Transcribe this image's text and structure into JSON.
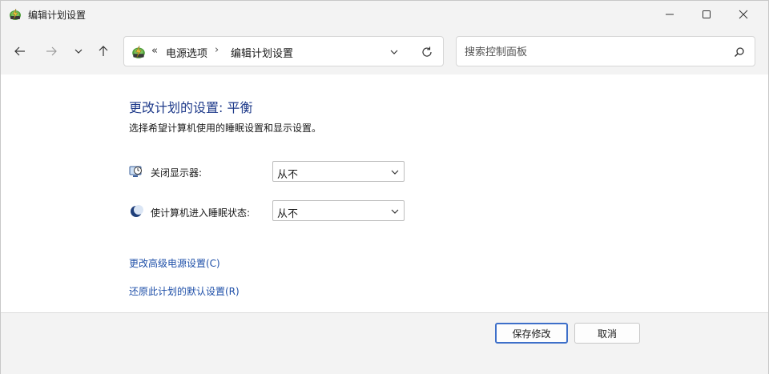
{
  "window": {
    "title": "编辑计划设置",
    "minimize_icon": "minimize-icon",
    "maximize_icon": "maximize-icon",
    "close_icon": "close-icon"
  },
  "nav": {
    "back_icon": "arrow-left-icon",
    "forward_icon": "arrow-right-icon",
    "recent_icon": "chevron-down-icon",
    "up_icon": "arrow-up-icon"
  },
  "address": {
    "overflow": "«",
    "crumbs": [
      "电源选项",
      "编辑计划设置"
    ],
    "separator": "›"
  },
  "search": {
    "placeholder": "搜索控制面板"
  },
  "main": {
    "title": "更改计划的设置: 平衡",
    "subtitle": "选择希望计算机使用的睡眠设置和显示设置。",
    "settings": [
      {
        "label": "关闭显示器:",
        "value": "从不",
        "icon": "display-timer-icon"
      },
      {
        "label": "使计算机进入睡眠状态:",
        "value": "从不",
        "icon": "moon-sleep-icon"
      }
    ],
    "links": [
      "更改高级电源设置(C)",
      "还原此计划的默认设置(R)"
    ]
  },
  "footer": {
    "save_label": "保存修改",
    "cancel_label": "取消"
  },
  "colors": {
    "title_blue": "#1e3a8a",
    "link_blue": "#1e4fa8",
    "primary_border": "#3d6fc9",
    "chrome_bg": "#f3f3f3"
  }
}
